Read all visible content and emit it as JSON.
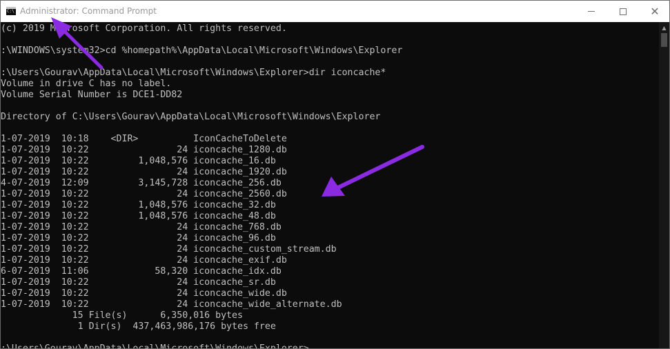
{
  "window": {
    "title": "Administrator: Command Prompt",
    "icon": "cmd-icon",
    "controls": {
      "minimize": "minimize-icon",
      "maximize": "maximize-icon",
      "close": "close-icon",
      "close_glyph": "✕"
    }
  },
  "console": {
    "lines": [
      " (c) 2019 Microsoft Corporation. All rights reserved.",
      "",
      "C:\\WINDOWS\\system32>cd %homepath%\\AppData\\Local\\Microsoft\\Windows\\Explorer",
      "",
      "C:\\Users\\Gourav\\AppData\\Local\\Microsoft\\Windows\\Explorer>dir iconcache*",
      " Volume in drive C has no label.",
      " Volume Serial Number is DCE1-DD82",
      "",
      " Directory of C:\\Users\\Gourav\\AppData\\Local\\Microsoft\\Windows\\Explorer",
      "",
      "01-07-2019  10:18    <DIR>          IconCacheToDelete",
      "01-07-2019  10:22                24 iconcache_1280.db",
      "01-07-2019  10:22         1,048,576 iconcache_16.db",
      "01-07-2019  10:22                24 iconcache_1920.db",
      "04-07-2019  12:09         3,145,728 iconcache_256.db",
      "01-07-2019  10:22                24 iconcache_2560.db",
      "01-07-2019  10:22         1,048,576 iconcache_32.db",
      "01-07-2019  10:22         1,048,576 iconcache_48.db",
      "01-07-2019  10:22                24 iconcache_768.db",
      "01-07-2019  10:22                24 iconcache_96.db",
      "01-07-2019  10:22                24 iconcache_custom_stream.db",
      "01-07-2019  10:22                24 iconcache_exif.db",
      "06-07-2019  11:06            58,320 iconcache_idx.db",
      "01-07-2019  10:22                24 iconcache_sr.db",
      "01-07-2019  10:22                24 iconcache_wide.db",
      "01-07-2019  10:22                24 iconcache_wide_alternate.db",
      "              15 File(s)      6,350,016 bytes",
      "               1 Dir(s)  437,463,986,176 bytes free",
      "",
      "C:\\Users\\Gourav\\AppData\\Local\\Microsoft\\Windows\\Explorer>"
    ]
  },
  "scrollbar": {
    "up_arrow": "▲"
  },
  "colors": {
    "console_bg": "#0c0c0c",
    "console_text": "#c0c0c0",
    "arrow": "#8a2be2"
  }
}
